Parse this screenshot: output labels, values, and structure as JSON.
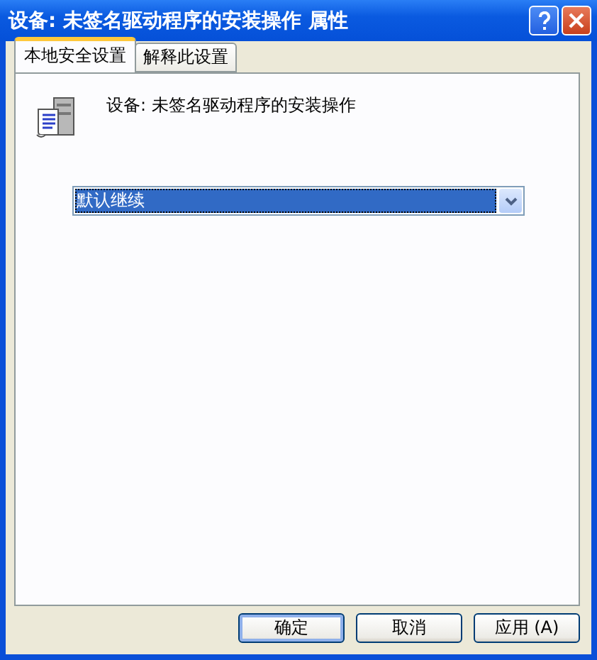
{
  "window": {
    "title": "设备: 未签名驱动程序的安装操作 属性"
  },
  "tabs": [
    {
      "label": "本地安全设置",
      "selected": true
    },
    {
      "label": "解释此设置",
      "selected": false
    }
  ],
  "policy": {
    "name": "设备: 未签名驱动程序的安装操作"
  },
  "dropdown": {
    "value": "默认继续"
  },
  "buttons": [
    {
      "label": "确定",
      "default": true
    },
    {
      "label": "取消",
      "default": false
    },
    {
      "label": "应用 (A)",
      "default": false
    }
  ]
}
